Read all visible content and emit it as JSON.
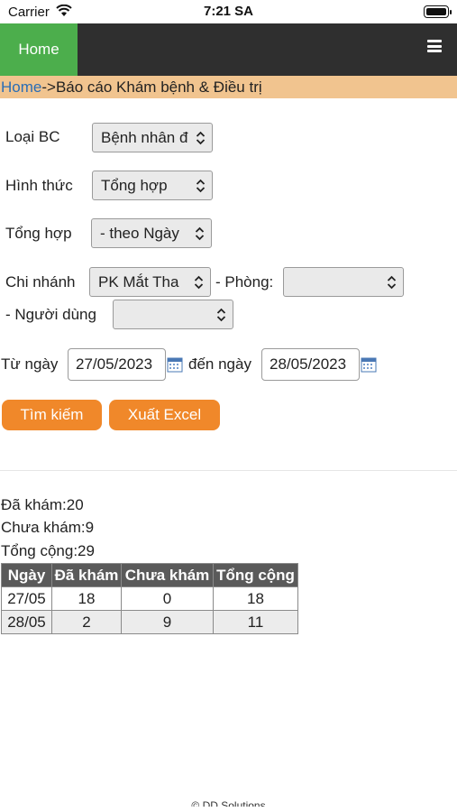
{
  "status_bar": {
    "carrier": "Carrier",
    "time": "7:21 SA"
  },
  "navbar": {
    "home_label": "Home",
    "menu_icon": "hamburger-icon"
  },
  "breadcrumb": {
    "home": "Home",
    "separator": "->",
    "current": "Báo cáo Khám bệnh & Điều trị"
  },
  "form": {
    "loai_bc": {
      "label": "Loại BC",
      "value": "Bệnh nhân đ"
    },
    "hinh_thuc": {
      "label": "Hình thức",
      "value": "Tổng hợp"
    },
    "tong_hop": {
      "label": "Tổng hợp",
      "value": "- theo Ngày"
    },
    "chi_nhanh": {
      "label": "Chi nhánh",
      "value": "PK Mắt Tha"
    },
    "phong": {
      "label": "- Phòng:",
      "value": ""
    },
    "nguoi_dung": {
      "label": "- Người dùng",
      "value": ""
    },
    "tu_ngay": {
      "label": "Từ ngày",
      "value": "27/05/2023"
    },
    "den_ngay": {
      "label": "đến ngày",
      "value": "28/05/2023"
    }
  },
  "buttons": {
    "search": "Tìm kiếm",
    "export": "Xuất Excel"
  },
  "summary": {
    "da_kham": "Đã khám:20",
    "chua_kham": "Chưa khám:9",
    "tong_cong": "Tổng cộng:29"
  },
  "table": {
    "headers": [
      "Ngày",
      "Đã khám",
      "Chưa khám",
      "Tổng cộng"
    ],
    "rows": [
      [
        "27/05",
        "18",
        "0",
        "18"
      ],
      [
        "28/05",
        "2",
        "9",
        "11"
      ]
    ]
  },
  "footer": "© DD Solutions",
  "colors": {
    "navbar": "#2f2f2f",
    "home": "#4cae4c",
    "breadcrumb": "#f1c48f",
    "button": "#f0882a",
    "table_header": "#5a5a5a"
  }
}
